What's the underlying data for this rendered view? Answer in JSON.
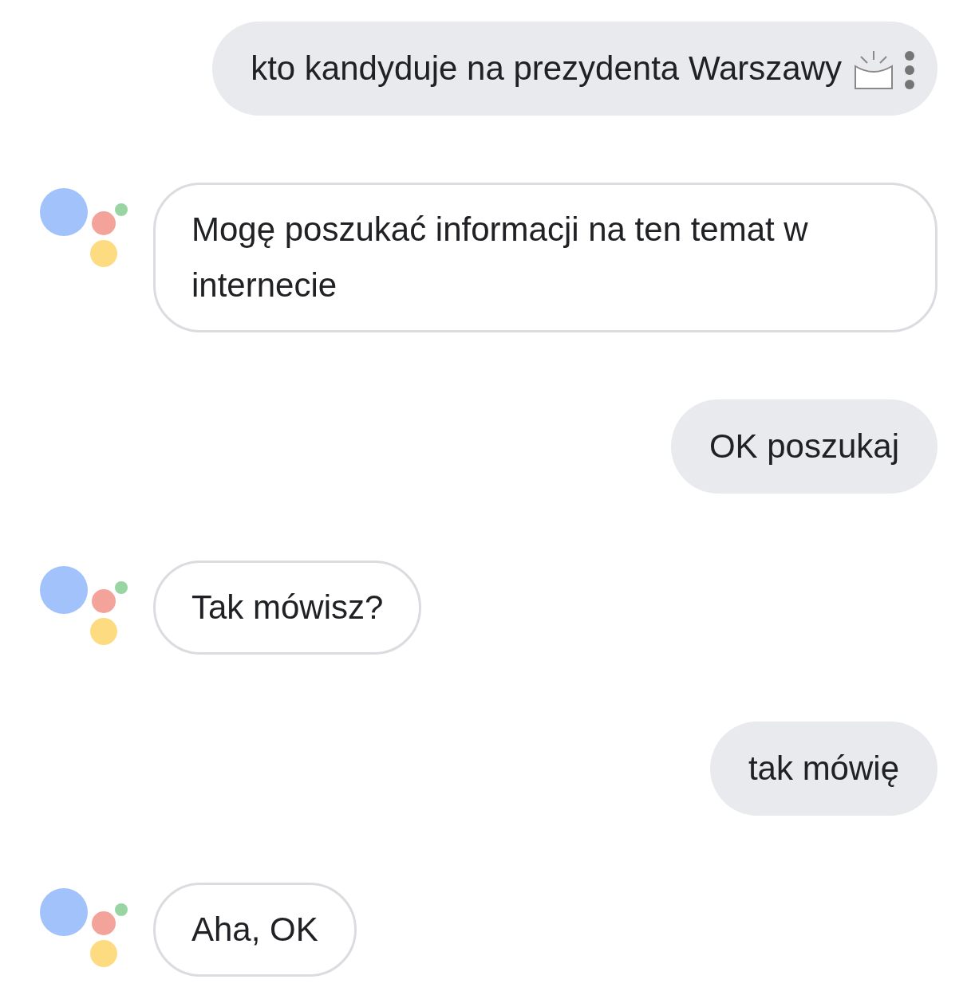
{
  "messages": [
    {
      "kind": "user",
      "text": "kto kandyduje na prezydenta Warszawy",
      "menu": true
    },
    {
      "kind": "assistant",
      "text": "Mogę poszukać informacji na ten temat w internecie"
    },
    {
      "kind": "user",
      "text": "OK poszukaj"
    },
    {
      "kind": "assistant",
      "text": "Tak mówisz?"
    },
    {
      "kind": "user",
      "text": "tak mówię"
    },
    {
      "kind": "assistant",
      "text": "Aha, OK"
    }
  ]
}
